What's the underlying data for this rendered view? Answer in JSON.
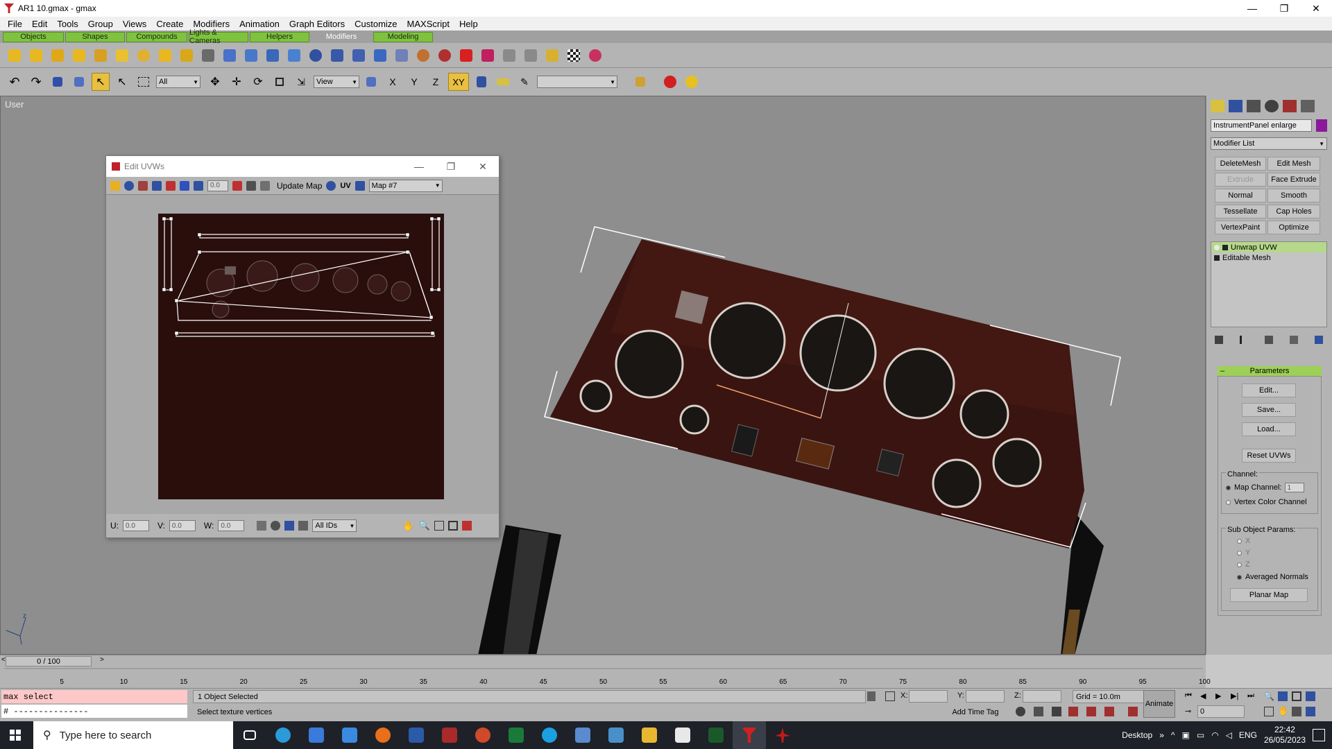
{
  "window": {
    "title": "AR1 10.gmax - gmax",
    "minimize": "—",
    "maximize": "❐",
    "close": "✕"
  },
  "menu": [
    "File",
    "Edit",
    "Tools",
    "Group",
    "Views",
    "Create",
    "Modifiers",
    "Animation",
    "Graph Editors",
    "Customize",
    "MAXScript",
    "Help"
  ],
  "tabs": [
    "Objects",
    "Shapes",
    "Compounds",
    "Lights & Cameras",
    "Helpers",
    "Modifiers",
    "Modeling"
  ],
  "active_tab": "Modifiers",
  "toolbar2": {
    "selection_filter": "All",
    "ref_coord": "View",
    "axis_xy": "XY",
    "axis_x": "X",
    "axis_y": "Y",
    "axis_z": "Z",
    "named_selection": ""
  },
  "viewport": {
    "label": "User"
  },
  "uvw_editor": {
    "title": "Edit UVWs",
    "value_field": "0.0",
    "update_map": "Update Map",
    "uv_label": "UV",
    "map_select": "Map #7",
    "u_label": "U:",
    "u_value": "0.0",
    "v_label": "V:",
    "v_value": "0.0",
    "w_label": "W:",
    "w_value": "0.0",
    "ids_select": "All IDs"
  },
  "command_panel": {
    "object_name": "InstrumentPanel enlarge",
    "object_color": "#8a1a9a",
    "modifier_list": "Modifier List",
    "buttons": [
      "DeleteMesh",
      "Edit Mesh",
      "Extrude",
      "Face Extrude",
      "Normal",
      "Smooth",
      "Tessellate",
      "Cap Holes",
      "VertexPaint",
      "Optimize"
    ],
    "stack": [
      "Unwrap UVW",
      "Editable Mesh"
    ],
    "parameters_header": "Parameters",
    "edit_btn": "Edit...",
    "save_btn": "Save...",
    "load_btn": "Load...",
    "reset_btn": "Reset UVWs",
    "channel_label": "Channel:",
    "map_channel_label": "Map Channel:",
    "map_channel_value": "1",
    "vertex_color_label": "Vertex Color Channel",
    "sub_object_label": "Sub Object Params:",
    "axis_x": "X",
    "axis_y": "Y",
    "axis_z": "Z",
    "averaged_normals": "Averaged Normals",
    "planar_map": "Planar Map"
  },
  "timeline": {
    "frame": "0 / 100",
    "ticks": [
      "5",
      "10",
      "15",
      "20",
      "25",
      "30",
      "35",
      "40",
      "45",
      "50",
      "55",
      "60",
      "65",
      "70",
      "75",
      "80",
      "85",
      "90",
      "95",
      "100"
    ]
  },
  "status": {
    "maxscript_line": "max select",
    "maxscript_line2": "# ---------------",
    "selection": "1 Object Selected",
    "prompt": "Select texture vertices",
    "x_label": "X:",
    "y_label": "Y:",
    "z_label": "Z:",
    "grid": "Grid = 10.0m",
    "add_time_tag": "Add Time Tag",
    "animate": "Animate",
    "frame_field": "0"
  },
  "taskbar": {
    "search_placeholder": "Type here to search",
    "desktop": "Desktop",
    "lang": "ENG",
    "time": "22:42",
    "date": "26/05/2023"
  }
}
